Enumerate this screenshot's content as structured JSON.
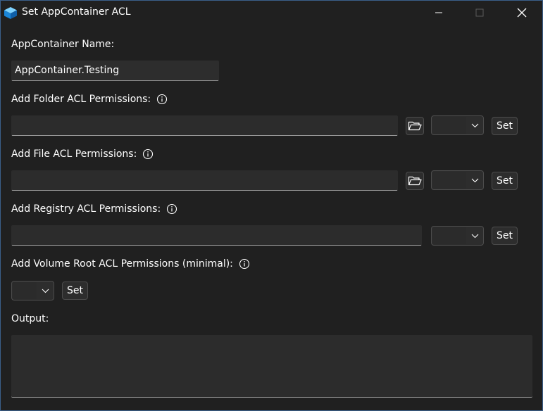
{
  "window": {
    "title": "Set AppContainer ACL",
    "app_icon": "appcontainer-cube-icon",
    "controls": {
      "minimize_icon": "minimize-icon",
      "maximize_icon": "maximize-icon",
      "close_icon": "close-icon"
    }
  },
  "appcontainer": {
    "label": "AppContainer Name:",
    "value": "AppContainer.Testing"
  },
  "folder_acl": {
    "label": "Add Folder ACL Permissions:",
    "value": "",
    "browse_icon": "folder-open-icon",
    "selected_permission": "",
    "set_label": "Set"
  },
  "file_acl": {
    "label": "Add File ACL Permissions:",
    "value": "",
    "browse_icon": "folder-open-icon",
    "selected_permission": "",
    "set_label": "Set"
  },
  "registry_acl": {
    "label": "Add Registry ACL Permissions:",
    "value": "",
    "selected_permission": "",
    "set_label": "Set"
  },
  "volume_acl": {
    "label": "Add Volume Root ACL Permissions (minimal):",
    "selected_permission": "",
    "set_label": "Set"
  },
  "output": {
    "label": "Output:",
    "value": ""
  },
  "colors": {
    "background": "#202020",
    "field": "#2c2c2c",
    "border": "#4c4c4c",
    "text": "#ffffff",
    "window_border": "#3a5f8a"
  }
}
